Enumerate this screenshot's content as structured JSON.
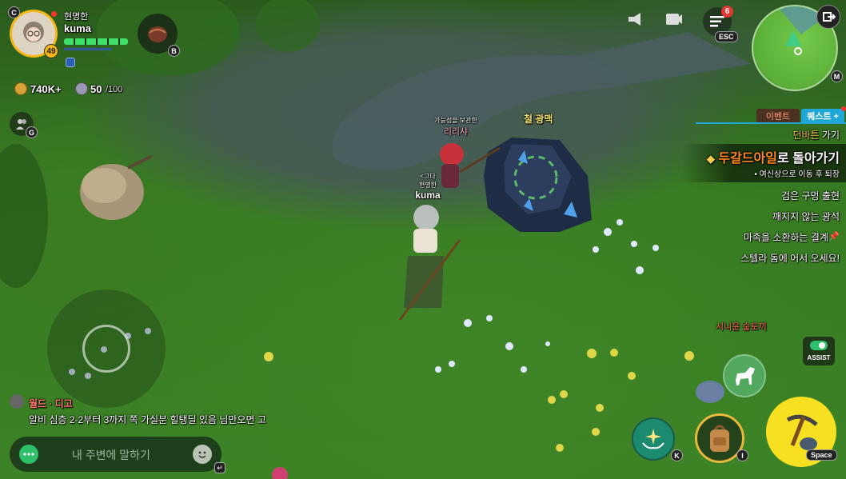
{
  "player": {
    "level": "49",
    "status_name": "현명한",
    "name": "kuma",
    "badge_c": "C"
  },
  "bag": {
    "key": "B"
  },
  "currency": {
    "gold": "740K+",
    "energy": "50",
    "energy_max": "/100"
  },
  "friends": {
    "key": "G"
  },
  "top_icons": {
    "menu_badge": "6",
    "menu_key": "ESC"
  },
  "minimap": {
    "key": "M"
  },
  "quest_tabs": {
    "event": "이벤트",
    "quest": "퀘스트 +"
  },
  "quest": {
    "location_prefix": "던바튼",
    "location_suffix": "가기",
    "main_title_highlight": "두갈드아일",
    "main_title_rest": "로 돌아가기",
    "main_sub": "• 여신상으로 이동 후 퇴장",
    "items": [
      "검은 구멍 출현",
      "깨지지 않는 광석",
      "마족을 소환하는 결계",
      "스텔라 돔에 어서 오세요!"
    ]
  },
  "world": {
    "npc_title": "가능성을 보관한",
    "npc_name": "리리샤",
    "ore_label": "철 광맥",
    "player_title_1": "<그다",
    "player_title_2": "현명한",
    "player_name": "kuma",
    "pet_label": "시니윤 숲토끼"
  },
  "chat": {
    "channel": "월드 · 디고",
    "message": "알비 심층 2-2부터 3까지 쪽 가실분 힐탱딜 있음 님만오면 고",
    "placeholder": "내 주변에 말하기"
  },
  "assist": {
    "label": "ASSIST"
  },
  "actions": {
    "skill_key": "K",
    "inventory_key": "I",
    "main_key": "Space"
  }
}
